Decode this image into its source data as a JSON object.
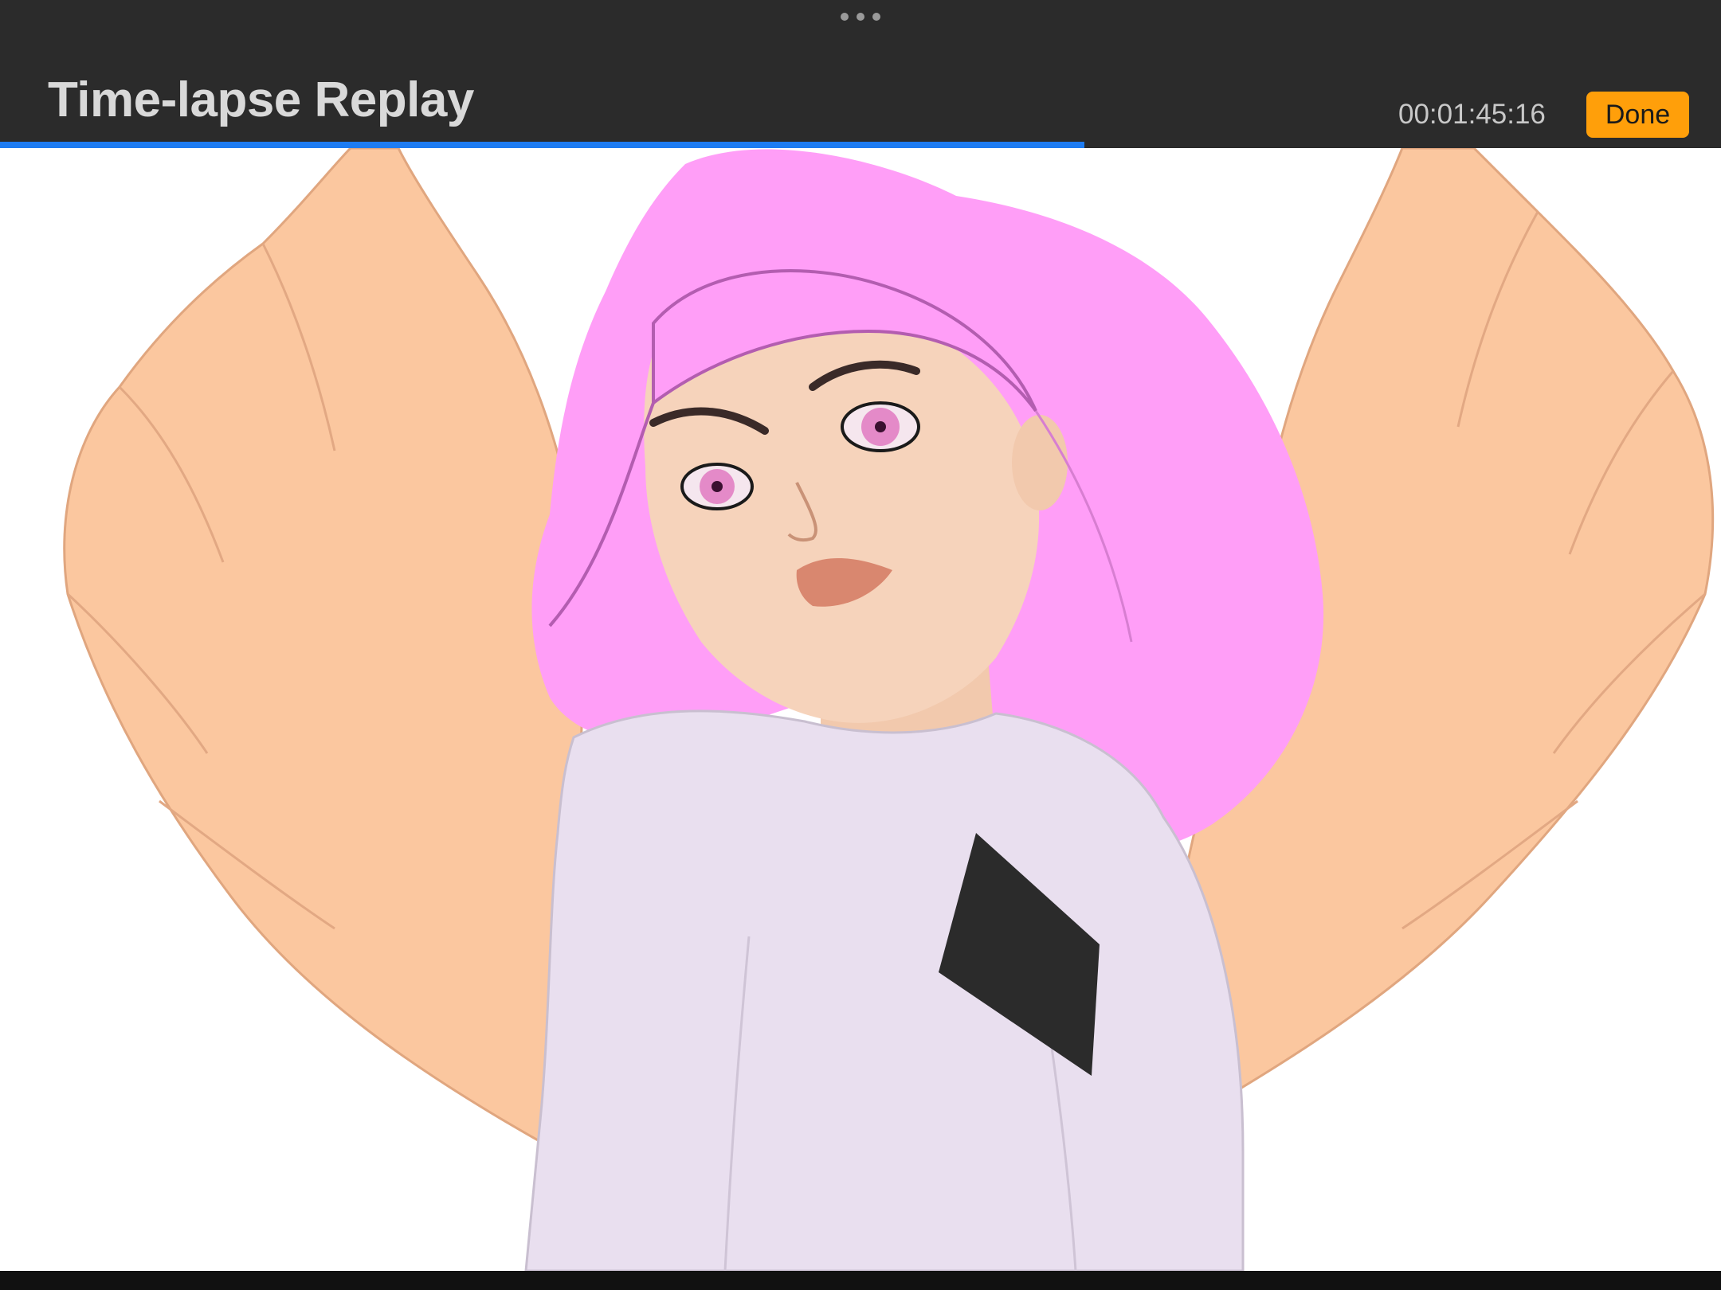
{
  "header": {
    "title": "Time-lapse Replay",
    "timecode": "00:01:45:16",
    "done_label": "Done"
  },
  "playback": {
    "progress": 0.63
  },
  "colors": {
    "header_bg": "#2b2b2b",
    "accent_orange": "#ff9f0a",
    "progress_blue": "#1e7cf2",
    "hair_pink": "#ff9ef7",
    "wing_peach": "#fbc79f",
    "shirt_lilac": "#e9dfef",
    "skin": "#f6d3bb"
  }
}
